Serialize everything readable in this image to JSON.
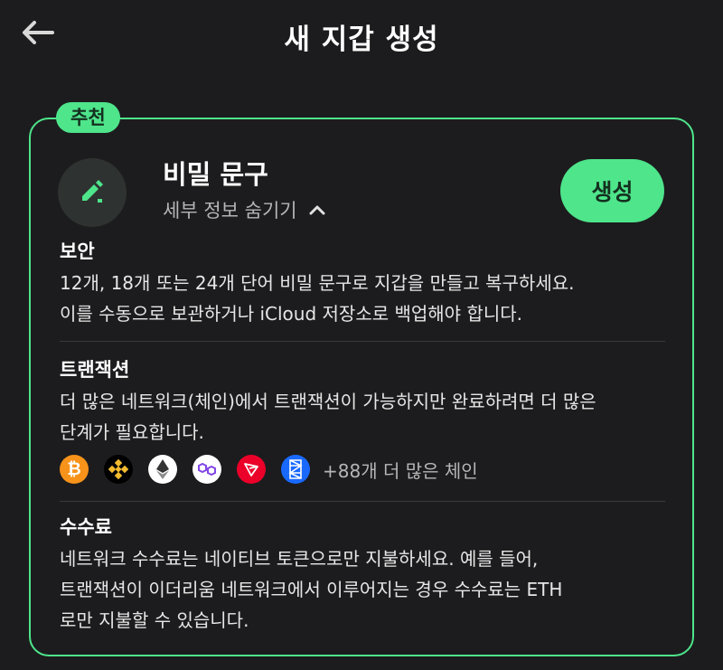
{
  "header": {
    "title": "새 지갑 생성"
  },
  "card": {
    "badge": "추천",
    "title": "비밀 문구",
    "details_toggle": "세부 정보 숨기기",
    "create_label": "생성",
    "security": {
      "title": "보안",
      "lines": [
        "12개, 18개 또는 24개 단어 비밀 문구로 지갑을 만들고 복구하세요.",
        "이를 수동으로 보관하거나 iCloud 저장소로 백업해야 합니다."
      ]
    },
    "transactions": {
      "title": "트랜잭션",
      "lines": [
        "더 많은 네트워크(체인)에서 트랜잭션이 가능하지만 완료하려면 더 많은",
        "단계가 필요합니다."
      ],
      "chains": [
        {
          "icon": "bitcoin-icon",
          "color": "#f7931a"
        },
        {
          "icon": "bnb-icon",
          "color": "#000000"
        },
        {
          "icon": "ethereum-icon",
          "color": "#ffffff"
        },
        {
          "icon": "polygon-icon",
          "color": "#ffffff"
        },
        {
          "icon": "tron-icon",
          "color": "#eb0029"
        },
        {
          "icon": "fantom-icon",
          "color": "#1969ff"
        }
      ],
      "more_chains": "+88개 더 많은 체인"
    },
    "fees": {
      "title": "수수료",
      "lines": [
        "네트워크 수수료는 네이티브 토큰으로만 지불하세요. 예를 들어,",
        "트랜잭션이 이더리움 네트워크에서 이루어지는 경우 수수료는 ETH",
        "로만 지불할 수 있습니다."
      ]
    }
  },
  "colors": {
    "accent": "#4ee58b",
    "background": "#1c1c1e"
  }
}
